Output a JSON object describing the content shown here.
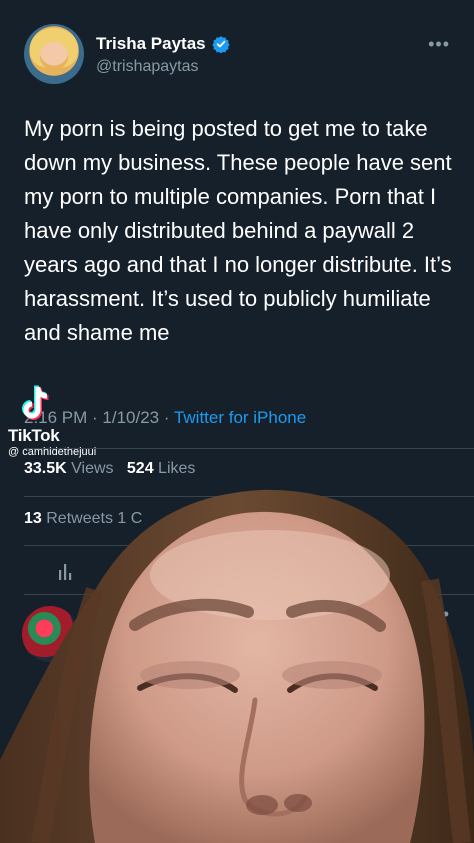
{
  "profile": {
    "display_name": "Trisha Paytas",
    "handle": "@trishapaytas",
    "verified": true,
    "more_icon": "ellipsis-icon"
  },
  "tweet": {
    "text": "My porn is being posted to get me to take down my business. These people have sent my porn to multiple companies. Porn that I have only distributed behind a paywall 2 years ago and that I no longer distribute. It’s harassment. It’s used to publicly humiliate and shame me",
    "time": "2:16 PM · 1/10/23 · ",
    "source": "Twitter for iPhone"
  },
  "stats": {
    "views_count": "33.5K",
    "views_label": "Views",
    "likes_count": "524",
    "likes_label": "Likes",
    "retweets_count": "13",
    "retweets_label": "Retweets",
    "retweets_extra": "1 C"
  },
  "tiktok": {
    "brand": "TikTok",
    "username": "@ camhidethejuul"
  },
  "actions": {
    "analytics_icon": "analytics-icon",
    "share_icon": "share-icon"
  },
  "colors": {
    "background": "#15202b",
    "secondary_text": "#8899a6",
    "accent": "#1d9bf0"
  }
}
